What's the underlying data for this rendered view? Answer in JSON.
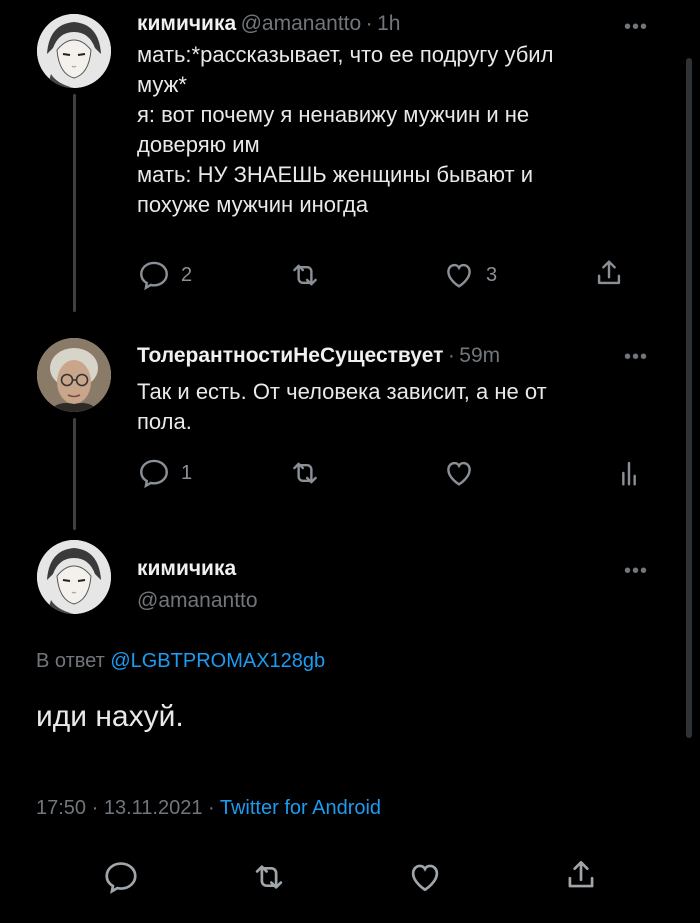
{
  "tweets": [
    {
      "name": "кимичика",
      "handle": "@amanantto",
      "separator": "·",
      "time": "1h",
      "more": "•••",
      "text": "мать:*рассказывает, что ее подругу убил\nмуж*\nя: вот почему я ненавижу мужчин и не\nдоверяю им\nмать: НУ ЗНАЕШЬ женщины бывают и\nпохуже мужчин иногда",
      "replies": "2",
      "likes": "3"
    },
    {
      "name": "ТолерантностиНеСуществует",
      "separator": "·",
      "time": "59m",
      "more": "•••",
      "text": "Так и есть. От человека зависит, а не от\nпола.",
      "replies": "1"
    }
  ],
  "focused": {
    "name": "кимичика",
    "handle": "@amanantto",
    "more": "•••",
    "reply_prefix": "В ответ",
    "reply_to": "@LGBTPROMAX128gb",
    "text": "иди нахуй.",
    "timestamp": "17:50 · 13.11.2021 ·",
    "source": "Twitter for Android"
  },
  "colors": {
    "background": "#000000",
    "accent": "#1d9bf0",
    "muted": "#71767b"
  }
}
